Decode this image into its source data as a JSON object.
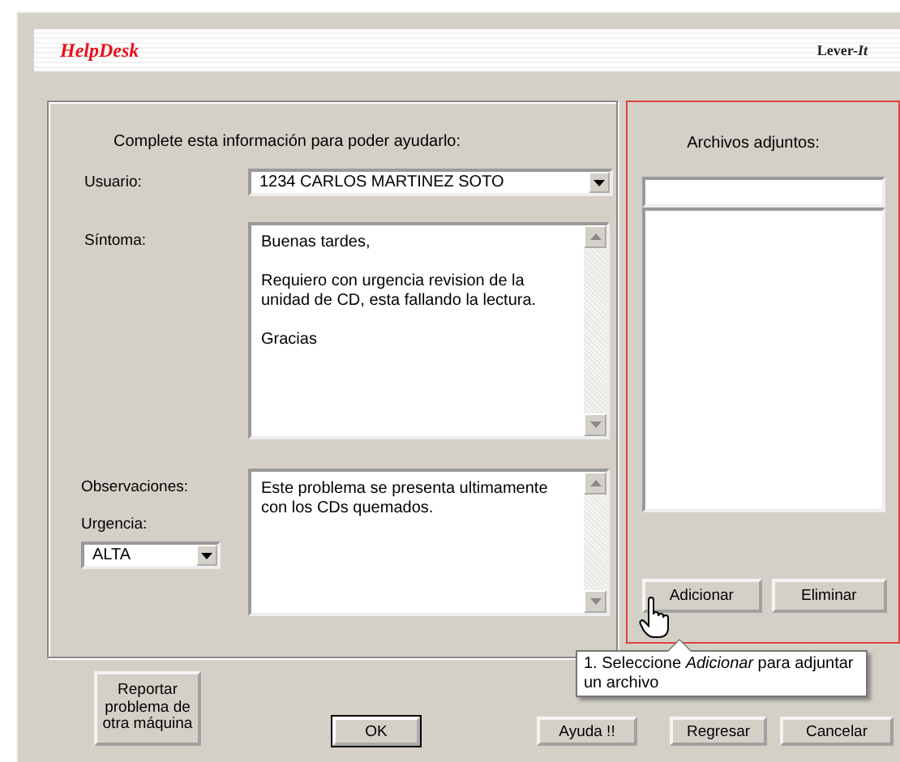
{
  "header": {
    "title": "HelpDesk",
    "logo": "Lever-*It*"
  },
  "form": {
    "intro": "Complete esta información para poder ayudarlo:",
    "user": {
      "label": "Usuario:",
      "value": "1234 CARLOS MARTINEZ SOTO"
    },
    "symptom": {
      "label": "Síntoma:",
      "value": "Buenas tardes,\n\nRequiero con urgencia revision de la\nunidad de CD, esta fallando la lectura.\n\nGracias"
    },
    "observations": {
      "label": "Observaciones:",
      "value": "Este problema se presenta ultimamente\ncon los CDs quemados."
    },
    "urgency": {
      "label": "Urgencia:",
      "value": "ALTA"
    }
  },
  "attachments": {
    "label": "Archivos adjuntos:",
    "buttons": [
      "Adicionar",
      "Eliminar"
    ]
  },
  "tooltip": "1. Seleccione *Adicionar* para adjuntar un archivo",
  "report_button": "Reportar problema de otra máquina",
  "buttons": [
    "OK",
    "Ayuda !!",
    "Regresar",
    "Cancelar"
  ]
}
